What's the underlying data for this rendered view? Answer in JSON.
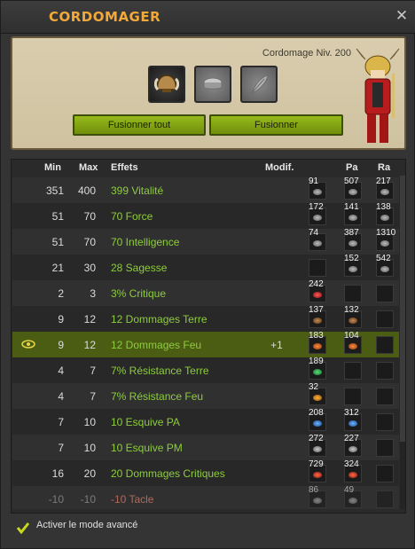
{
  "window": {
    "title": "CORDOMAGER",
    "close_icon": "close-icon"
  },
  "panel": {
    "level_label": "Cordomage Niv. 200",
    "slots": [
      "horned-helmet-item-icon",
      "rune-slot-icon",
      "feather-slot-icon"
    ],
    "fuse_all_label": "Fusionner tout",
    "fuse_label": "Fusionner"
  },
  "columns": {
    "min": "Min",
    "max": "Max",
    "effects": "Effets",
    "modif": "Modif.",
    "pa": "Pa",
    "ra": "Ra"
  },
  "rows": [
    {
      "min": "351",
      "max": "400",
      "effect": "399 Vitalité",
      "modif": "",
      "ba": "91",
      "pa": "507",
      "ra": "217"
    },
    {
      "min": "51",
      "max": "70",
      "effect": "70 Force",
      "modif": "",
      "ba": "172",
      "pa": "141",
      "ra": "138"
    },
    {
      "min": "51",
      "max": "70",
      "effect": "70 Intelligence",
      "modif": "",
      "ba": "74",
      "pa": "387",
      "ra": "1310"
    },
    {
      "min": "21",
      "max": "30",
      "effect": "28 Sagesse",
      "modif": "",
      "ba": "",
      "pa": "152",
      "ra": "542"
    },
    {
      "min": "2",
      "max": "3",
      "effect": "3% Critique",
      "modif": "",
      "ba": "242",
      "pa": "",
      "ra": ""
    },
    {
      "min": "9",
      "max": "12",
      "effect": "12 Dommages Terre",
      "modif": "",
      "ba": "137",
      "pa": "132",
      "ra": ""
    },
    {
      "min": "9",
      "max": "12",
      "effect": "12 Dommages Feu",
      "modif": "+1",
      "ba": "183",
      "pa": "104",
      "ra": ""
    },
    {
      "min": "4",
      "max": "7",
      "effect": "7% Résistance Terre",
      "modif": "",
      "ba": "189",
      "pa": "",
      "ra": ""
    },
    {
      "min": "4",
      "max": "7",
      "effect": "7% Résistance Feu",
      "modif": "",
      "ba": "32",
      "pa": "",
      "ra": ""
    },
    {
      "min": "7",
      "max": "10",
      "effect": "10 Esquive PA",
      "modif": "",
      "ba": "208",
      "pa": "312",
      "ra": ""
    },
    {
      "min": "7",
      "max": "10",
      "effect": "10 Esquive PM",
      "modif": "",
      "ba": "272",
      "pa": "227",
      "ra": ""
    },
    {
      "min": "16",
      "max": "20",
      "effect": "20 Dommages Critiques",
      "modif": "",
      "ba": "729",
      "pa": "324",
      "ra": ""
    },
    {
      "min": "-10",
      "max": "-10",
      "effect": "-10 Tacle",
      "modif": "",
      "ba": "86",
      "pa": "49",
      "ra": ""
    }
  ],
  "footer": {
    "advanced_mode_label": "Activer le mode avancé",
    "advanced_mode_checked": true
  },
  "colors": {
    "title": "#f2a93b",
    "effect_positive": "#8dcd3d",
    "effect_negative": "#b06a5b",
    "highlight_row": "#4a5d12",
    "button": "#86a716"
  }
}
